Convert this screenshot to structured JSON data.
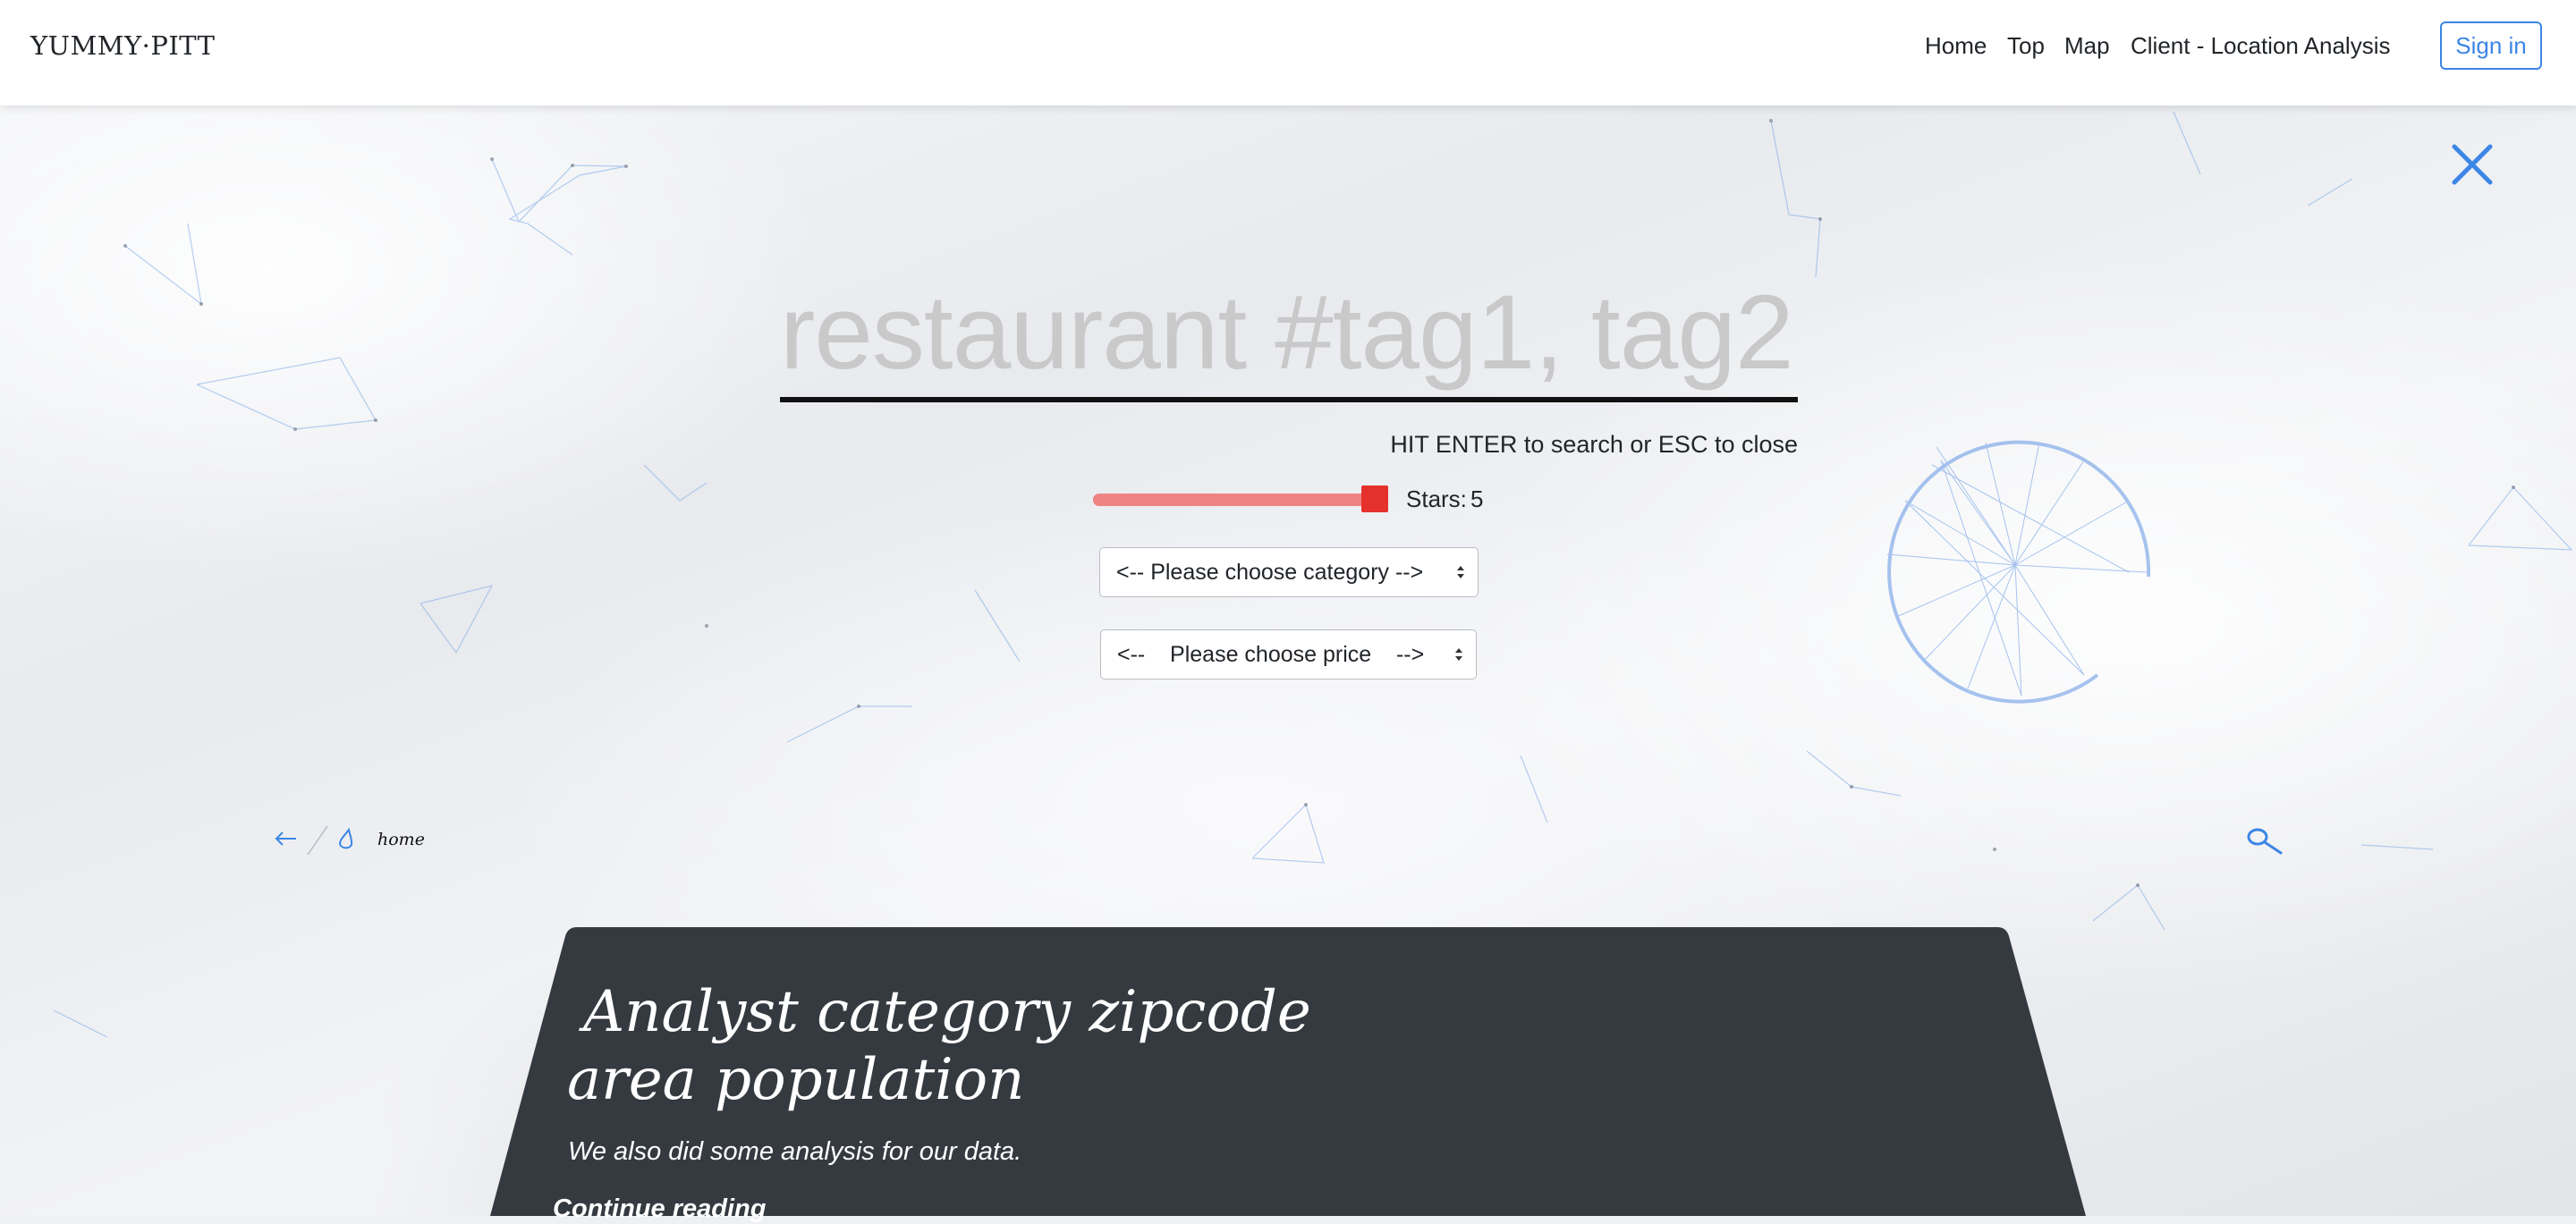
{
  "navbar": {
    "brand": "YUMMY·PITT",
    "links": [
      "Home",
      "Top",
      "Map",
      "Client - Location Analysis"
    ],
    "signin_label": "Sign in"
  },
  "search": {
    "placeholder": "restaurant #tag1, tag2",
    "hint": "HIT ENTER to search or ESC to close"
  },
  "filters": {
    "stars_label": "Stars:",
    "stars_value": "5",
    "stars_max": 5,
    "category_placeholder": "<-- Please choose category -->",
    "price_placeholder": "<--    Please choose price    -->"
  },
  "breadcrumb": {
    "current": "home"
  },
  "post": {
    "title_line1": "Analyst category zipcode",
    "title_line2": "area population",
    "description": "We also did some analysis for our data.",
    "link": "Continue reading"
  },
  "colors": {
    "accent": "#3c86e6",
    "slider_track": "#ef8383",
    "slider_thumb": "#e5312c",
    "card_bg": "#343a40"
  },
  "icons": [
    "close-icon",
    "back-arrow-icon",
    "drop-icon",
    "search-icon",
    "caret-icon"
  ]
}
